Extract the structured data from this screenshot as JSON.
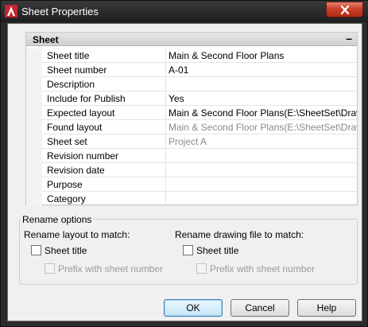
{
  "window": {
    "title": "Sheet Properties"
  },
  "section": {
    "title": "Sheet",
    "toggle": "–"
  },
  "properties": [
    {
      "name": "Sheet title",
      "value": "Main & Second Floor Plans"
    },
    {
      "name": "Sheet number",
      "value": "A-01"
    },
    {
      "name": "Description",
      "value": ""
    },
    {
      "name": "Include for Publish",
      "value": "Yes"
    },
    {
      "name": "Expected layout",
      "value": "Main & Second Floor Plans(E:\\SheetSet\\Drawi..."
    },
    {
      "name": "Found layout",
      "value": "Main & Second Floor Plans(E:\\SheetSet\\Drawi..."
    },
    {
      "name": "Sheet set",
      "value": "Project A"
    },
    {
      "name": "Revision number",
      "value": ""
    },
    {
      "name": "Revision date",
      "value": ""
    },
    {
      "name": "Purpose",
      "value": ""
    },
    {
      "name": "Category",
      "value": ""
    }
  ],
  "rename": {
    "legend": "Rename options",
    "layout_label": "Rename layout to match:",
    "drawing_label": "Rename drawing file to match:",
    "sheet_title": "Sheet title",
    "prefix": "Prefix with sheet number"
  },
  "buttons": {
    "ok": "OK",
    "cancel": "Cancel",
    "help": "Help"
  },
  "colors": {
    "accent": "#3c7fb1",
    "close": "#c8402a",
    "app_icon": "#c1272d"
  }
}
